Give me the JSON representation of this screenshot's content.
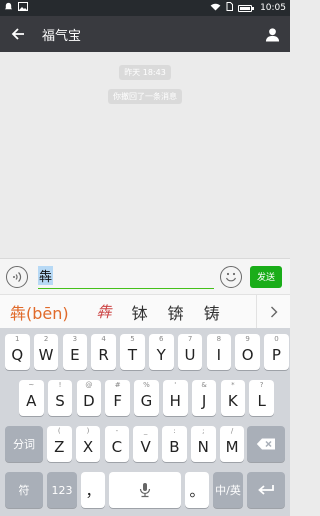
{
  "status_bar": {
    "time": "10:05"
  },
  "header": {
    "title": "福气宝"
  },
  "chat": {
    "timestamp": "昨天 18:43",
    "notice": "你撤回了一条消息"
  },
  "input": {
    "value": "犇",
    "send_label": "发送"
  },
  "candidates": {
    "primary": "犇(bēn)",
    "handwriting": "犇",
    "items": [
      "钵",
      "锛",
      "铸"
    ]
  },
  "keyboard": {
    "row1": [
      {
        "k": "Q",
        "h": "1"
      },
      {
        "k": "W",
        "h": "2"
      },
      {
        "k": "E",
        "h": "3"
      },
      {
        "k": "R",
        "h": "4"
      },
      {
        "k": "T",
        "h": "5"
      },
      {
        "k": "Y",
        "h": "6"
      },
      {
        "k": "U",
        "h": "7"
      },
      {
        "k": "I",
        "h": "8"
      },
      {
        "k": "O",
        "h": "9"
      },
      {
        "k": "P",
        "h": "0"
      }
    ],
    "row2": [
      {
        "k": "A",
        "h": "~"
      },
      {
        "k": "S",
        "h": "!"
      },
      {
        "k": "D",
        "h": "@"
      },
      {
        "k": "F",
        "h": "#"
      },
      {
        "k": "G",
        "h": "%"
      },
      {
        "k": "H",
        "h": "'"
      },
      {
        "k": "J",
        "h": "&"
      },
      {
        "k": "K",
        "h": "*"
      },
      {
        "k": "L",
        "h": "?"
      }
    ],
    "row3": [
      {
        "k": "Z",
        "h": "("
      },
      {
        "k": "X",
        "h": ")"
      },
      {
        "k": "C",
        "h": "-"
      },
      {
        "k": "V",
        "h": "_"
      },
      {
        "k": "B",
        "h": ":"
      },
      {
        "k": "N",
        "h": ";"
      },
      {
        "k": "M",
        "h": "/"
      }
    ],
    "segment_label": "分词",
    "symbol_label": "符",
    "num_label": "123",
    "comma": "，",
    "period": "。",
    "lang_label": "中/英"
  }
}
